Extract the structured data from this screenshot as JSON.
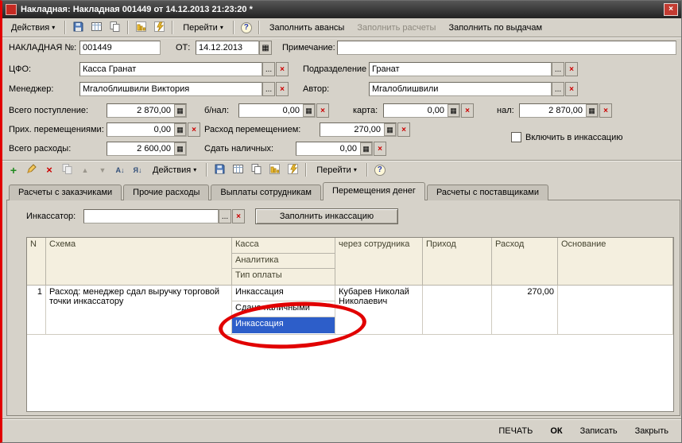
{
  "window": {
    "title": "Накладная: Накладная 001449 от 14.12.2013 21:23:20 *"
  },
  "colors": {
    "window_bg": "#d6d2c9",
    "titlebar_dark": "#565656",
    "selection_blue": "#2d5ec9",
    "annotation_red": "#e10000",
    "header_beige": "#f4efdf"
  },
  "icons": {
    "close": "×",
    "menu_arrow": "▾",
    "help": "?",
    "dots": "...",
    "clear": "×",
    "calc": "▦",
    "calendar": "▦",
    "add": "+",
    "delete": "×",
    "move_up": "▲",
    "move_down": "▼",
    "sort_asc": "А↓",
    "sort_desc": "Я↓"
  },
  "toolbar_top": {
    "actions": "Действия",
    "go": "Перейти",
    "fill_advances": "Заполнить авансы",
    "fill_settlements": "Заполнить расчеты",
    "fill_by_payouts": "Заполнить по выдачам"
  },
  "form": {
    "invoice": {
      "label": "НАКЛАДНАЯ №:",
      "value": "001449"
    },
    "date": {
      "label": "ОТ:",
      "value": "14.12.2013"
    },
    "note": {
      "label": "Примечание:",
      "value": ""
    },
    "cfo": {
      "label": "ЦФО:",
      "value": "Касса Гранат"
    },
    "division": {
      "label": "Подразделение",
      "value": "Гранат"
    },
    "manager": {
      "label": "Менеджер:",
      "value": "Мгалоблишвили Виктория"
    },
    "author": {
      "label": "Автор:",
      "value": "Мгалоблишвили"
    },
    "total_income": {
      "label": "Всего поступление:",
      "value": "2 870,00"
    },
    "cashless": {
      "label": "б/нал:",
      "value": "0,00"
    },
    "card": {
      "label": "карта:",
      "value": "0,00"
    },
    "cash": {
      "label": "нал:",
      "value": "2 870,00"
    },
    "incoming_transfers": {
      "label": "Прих. перемещениями:",
      "value": "0,00"
    },
    "outgoing_transfer": {
      "label": "Расход перемещением:",
      "value": "270,00"
    },
    "include_in_collection": {
      "label": "Включить в инкассацию",
      "checked": false
    },
    "total_expenses": {
      "label": "Всего расходы:",
      "value": "2 600,00"
    },
    "cash_to_handover": {
      "label": "Сдать наличных:",
      "value": "0,00"
    }
  },
  "table_toolbar": {
    "actions": "Действия",
    "go": "Перейти"
  },
  "tabs": {
    "items": [
      "Расчеты с заказчиками",
      "Прочие расходы",
      "Выплаты сотрудникам",
      "Перемещения денег",
      "Расчеты с поставщиками"
    ],
    "active_index": 3
  },
  "panel": {
    "collector_label": "Инкассатор:",
    "collector_value": "",
    "fill_collection_button": "Заполнить инкассацию"
  },
  "table": {
    "headers": {
      "n": "N",
      "schema": "Схема",
      "kassa": "Касса",
      "analytics": "Аналитика",
      "pay_type": "Тип оплаты",
      "via_employee": "через сотрудника",
      "income": "Приход",
      "expense": "Расход",
      "basis": "Основание"
    },
    "rows": [
      {
        "n": "1",
        "schema": "Расход: менеджер сдал выручку торговой точки инкассатору",
        "kassa": "Инкассация",
        "analytics": "Сдано наличными",
        "pay_type": "Инкассация",
        "via_employee": "Кубарев Николай Николаевич",
        "income": "",
        "expense": "270,00",
        "basis": ""
      }
    ]
  },
  "statusbar": {
    "print": "ПЕЧАТЬ",
    "ok": "ОК",
    "save": "Записать",
    "close": "Закрыть"
  }
}
